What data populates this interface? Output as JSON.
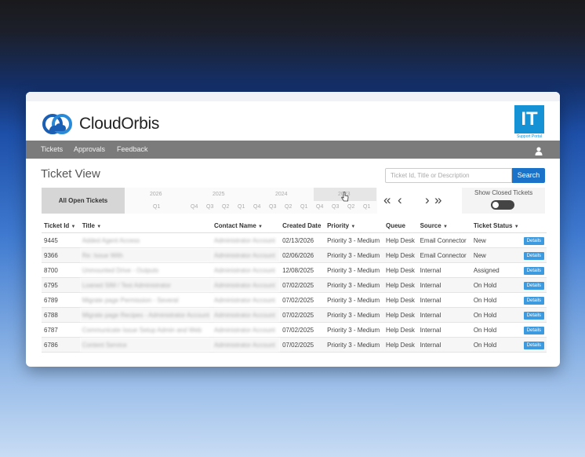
{
  "brand": {
    "name_part1": "Cloud",
    "name_part2": "Orbis",
    "badge_text": "IT",
    "badge_sub": "Support Portal"
  },
  "nav": {
    "items": [
      "Tickets",
      "Approvals",
      "Feedback"
    ]
  },
  "page": {
    "title": "Ticket View"
  },
  "search": {
    "placeholder": "Ticket Id, Title or Description",
    "button": "Search"
  },
  "filters": {
    "all_open": "All Open Tickets",
    "show_closed_label": "Show Closed Tickets",
    "show_closed_on": false
  },
  "timeline": {
    "years": [
      "2026",
      "2025",
      "2024",
      "2023"
    ],
    "quarters": [
      "Q1",
      "Q4",
      "Q3",
      "Q2",
      "Q1",
      "Q4",
      "Q3",
      "Q2",
      "Q1",
      "Q4",
      "Q3",
      "Q2",
      "Q1"
    ]
  },
  "pager": {
    "first": "«",
    "prev": "‹",
    "next": "›",
    "last": "»"
  },
  "table": {
    "columns": [
      "Ticket Id",
      "Title",
      "Contact Name",
      "Created Date",
      "Priority",
      "Queue",
      "Source",
      "Ticket Status"
    ],
    "details_label": "Details",
    "rows": [
      {
        "id": "9445",
        "title": "Added Agent Access",
        "contact": "Administrator Account",
        "created": "02/13/2026",
        "priority": "Priority 3 - Medium",
        "queue": "Help Desk",
        "source": "Email Connector",
        "status": "New"
      },
      {
        "id": "9366",
        "title": "Re: Issue With",
        "contact": "Administrator Account",
        "created": "02/06/2026",
        "priority": "Priority 3 - Medium",
        "queue": "Help Desk",
        "source": "Email Connector",
        "status": "New"
      },
      {
        "id": "8700",
        "title": "Unmounted Drive - Outputs",
        "contact": "Administrator Account",
        "created": "12/08/2025",
        "priority": "Priority 3 - Medium",
        "queue": "Help Desk",
        "source": "Internal",
        "status": "Assigned"
      },
      {
        "id": "6795",
        "title": "Loaned SIM / Test Administrator",
        "contact": "Administrator Account",
        "created": "07/02/2025",
        "priority": "Priority 3 - Medium",
        "queue": "Help Desk",
        "source": "Internal",
        "status": "On Hold"
      },
      {
        "id": "6789",
        "title": "Migrate page Permission - Several",
        "contact": "Administrator Account",
        "created": "07/02/2025",
        "priority": "Priority 3 - Medium",
        "queue": "Help Desk",
        "source": "Internal",
        "status": "On Hold"
      },
      {
        "id": "6788",
        "title": "Migrate page Recipes - Administrator Account",
        "contact": "Administrator Account",
        "created": "07/02/2025",
        "priority": "Priority 3 - Medium",
        "queue": "Help Desk",
        "source": "Internal",
        "status": "On Hold"
      },
      {
        "id": "6787",
        "title": "Communicate Issue Setup Admin and Web",
        "contact": "Administrator Account",
        "created": "07/02/2025",
        "priority": "Priority 3 - Medium",
        "queue": "Help Desk",
        "source": "Internal",
        "status": "On Hold"
      },
      {
        "id": "6786",
        "title": "Content Service",
        "contact": "Administrator Account",
        "created": "07/02/2025",
        "priority": "Priority 3 - Medium",
        "queue": "Help Desk",
        "source": "Internal",
        "status": "On Hold"
      }
    ]
  },
  "colors": {
    "accent": "#1a73c8",
    "details_button": "#3b9ae0",
    "navbar": "#7b7b7b",
    "badge": "#1592d6"
  }
}
